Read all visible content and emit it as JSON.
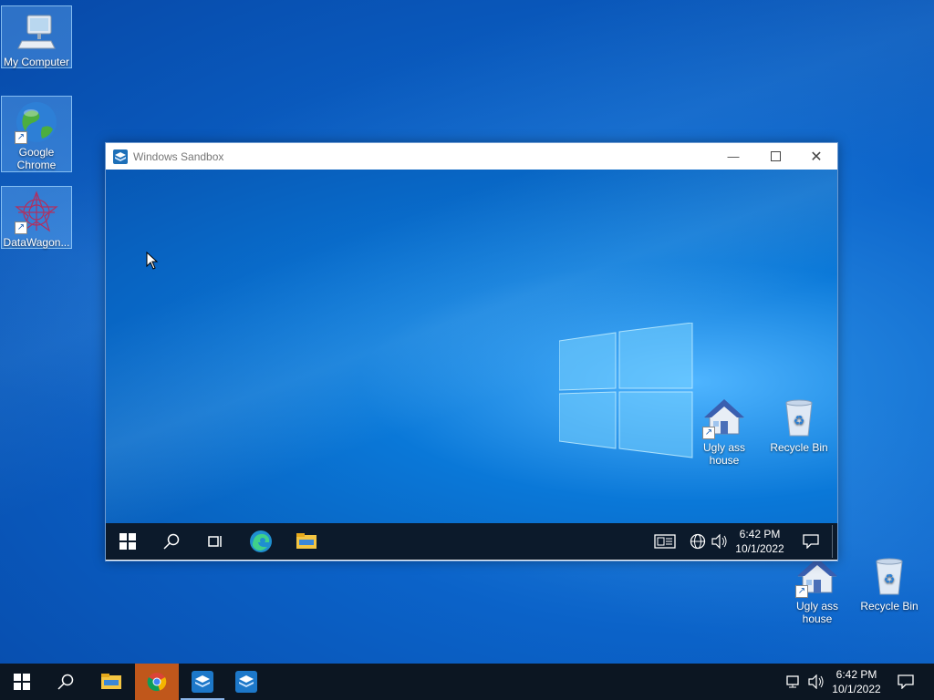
{
  "desktop": {
    "icons": [
      {
        "label": "My Computer"
      },
      {
        "label": "Google Chrome"
      },
      {
        "label": "DataWagon..."
      },
      {
        "label": "Ugly ass house"
      },
      {
        "label": "Recycle Bin"
      }
    ]
  },
  "sandbox_window": {
    "title": "Windows Sandbox",
    "desktop_icons": [
      {
        "label": "Ugly ass house"
      },
      {
        "label": "Recycle Bin"
      }
    ],
    "taskbar": {
      "time": "6:42 PM",
      "date": "10/1/2022"
    }
  },
  "taskbar": {
    "time": "6:42 PM",
    "date": "10/1/2022",
    "pinned": [
      "start",
      "search",
      "file-explorer",
      "chrome",
      "windows-sandbox",
      "windows-sandbox"
    ]
  },
  "colors": {
    "desktop_blue": "#0b63c9",
    "taskbar": "#0c1622",
    "chrome_active": "#c0571b"
  }
}
